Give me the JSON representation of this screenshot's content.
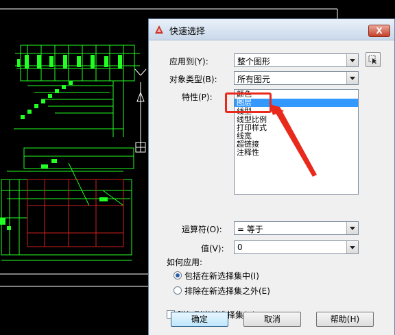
{
  "dialog": {
    "title": "快速选择",
    "close_label": "X",
    "apply_to": {
      "label": "应用到(Y):",
      "value": "整个图形"
    },
    "object_type": {
      "label": "对象类型(B):",
      "value": "所有图元"
    },
    "properties": {
      "label": "特性(P):",
      "items": [
        "颜色",
        "图层",
        "线型",
        "线型比例",
        "打印样式",
        "线宽",
        "超链接",
        "注释性"
      ],
      "selected_index": 1
    },
    "operator": {
      "label": "运算符(O):",
      "value": "= 等于"
    },
    "value": {
      "label": "值(V):",
      "value": "0"
    },
    "how_to_apply": {
      "label": "如何应用:",
      "options": [
        "包括在新选择集中(I)",
        "排除在新选择集之外(E)"
      ],
      "selected_index": 0
    },
    "append": {
      "label": "附加到当前选择集(A)",
      "checked": false
    },
    "buttons": {
      "ok": "确定",
      "cancel": "取消",
      "help": "帮助(H)"
    }
  },
  "colors": {
    "cad_line": "#22ff22",
    "cad_red": "#d02020",
    "highlight": "#e8291c",
    "selection": "#3399ff"
  }
}
